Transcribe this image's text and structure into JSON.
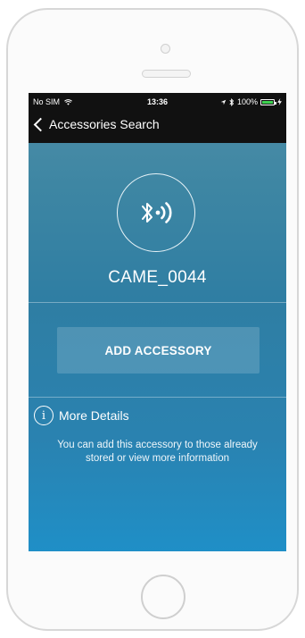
{
  "statusbar": {
    "carrier": "No SIM",
    "time": "13:36",
    "battery": "100%"
  },
  "navbar": {
    "back_label": "Accessories Search"
  },
  "device": {
    "name": "CAME_0044",
    "icon": "bluetooth-signal-icon"
  },
  "actions": {
    "add_label": "ADD ACCESSORY"
  },
  "details": {
    "label": "More Details",
    "description_line1": "You can add this accessory to those already",
    "description_line2": "stored or view more information"
  },
  "colors": {
    "bar_background": "#111111",
    "battery_fill": "#3dd14f",
    "screen_top": "#4f8fa8",
    "screen_bottom": "#1f8fc7"
  }
}
